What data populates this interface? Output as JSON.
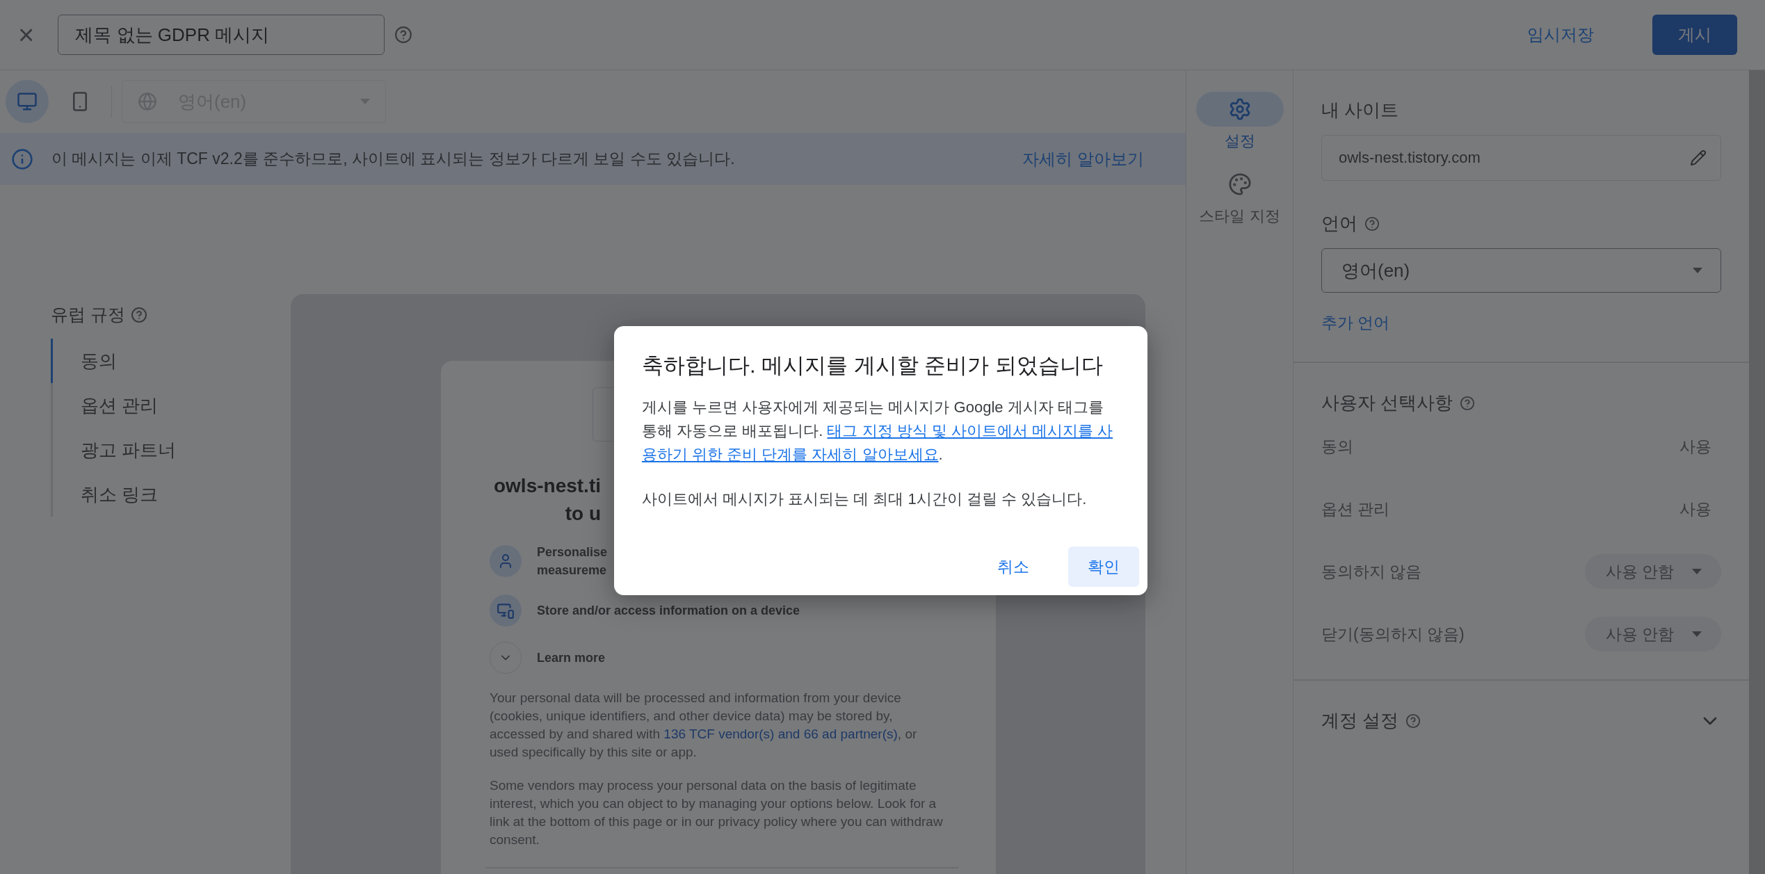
{
  "top_bar": {
    "close": "×",
    "title_value": "제목 없는 GDPR 메시지",
    "save_draft": "임시저장",
    "publish": "게시"
  },
  "toolbar": {
    "devices": [
      {
        "kind": "desktop",
        "selected": true
      },
      {
        "kind": "mobile",
        "selected": false
      }
    ],
    "language": "영어(en)"
  },
  "banner": {
    "text": "이 메시지는 이제 TCF v2.2를 준수하므로, 사이트에 표시되는 정보가 다르게 보일 수도 있습니다.",
    "link": "자세히 알아보기"
  },
  "nav": {
    "heading": "유럽 규정",
    "items": [
      {
        "label": "동의",
        "selected": true
      },
      {
        "label": "옵션 관리",
        "selected": false
      },
      {
        "label": "광고 파트너",
        "selected": false
      },
      {
        "label": "취소 링크",
        "selected": false
      }
    ]
  },
  "preview": {
    "title_lines": [
      "owls-nest.ti",
      "to u"
    ],
    "purposes": [
      {
        "kind": "person",
        "text": "Personalise measureme"
      },
      {
        "kind": "device",
        "text": "Store and/or access information on a device"
      }
    ],
    "learn_more": "Learn more",
    "paragraph_1": {
      "before": "Your personal data will be processed and information from your device (cookies, unique identifiers, and other device data) may be stored by, accessed by and shared with ",
      "link": "136 TCF vendor(s) and 66 ad partner(s)",
      "after": ", or used specifically by this site or app."
    },
    "paragraph_2": "Some vendors may process your personal data on the basis of legitimate interest, which you can object to by managing your options below. Look for a link at the bottom of this page or in our privacy policy where you can withdraw consent."
  },
  "rail": [
    {
      "kind": "settings",
      "label": "설정",
      "selected": true
    },
    {
      "kind": "style",
      "label": "스타일 지정",
      "selected": false
    }
  ],
  "panel": {
    "my_site": {
      "heading": "내 사이트",
      "value": "owls-nest.tistory.com"
    },
    "language": {
      "heading": "언어",
      "value": "영어(en)",
      "add": "추가 언어"
    },
    "choices": {
      "heading": "사용자 선택사항",
      "rows": [
        {
          "label": "동의",
          "kind": "text",
          "value": "사용"
        },
        {
          "label": "옵션 관리",
          "kind": "text",
          "value": "사용"
        },
        {
          "label": "동의하지 않음",
          "kind": "dropdown",
          "value": "사용 안함"
        },
        {
          "label": "닫기(동의하지 않음)",
          "kind": "dropdown",
          "value": "사용 안함"
        }
      ]
    },
    "account": {
      "heading": "계정 설정",
      "expanded": false
    }
  },
  "dialog": {
    "title": "축하합니다. 메시지를 게시할 준비가 되었습니다",
    "body": {
      "text": "게시를 누르면 사용자에게 제공되는 메시지가 Google 게시자 태그를 통해 자동으로 배포됩니다. ",
      "link_lines": [
        "태그 지정 방식 및 사이트에서 메시지를 사",
        "용하기 위한 준비 단계를 자세히 알아보세요"
      ],
      "after": "."
    },
    "note": "사이트에서 메시지가 표시되는 데 최대 1시간이 걸릴 수 있습니다.",
    "buttons": [
      {
        "kind": "text",
        "label": "취소"
      },
      {
        "kind": "tonal",
        "label": "확인"
      }
    ]
  }
}
